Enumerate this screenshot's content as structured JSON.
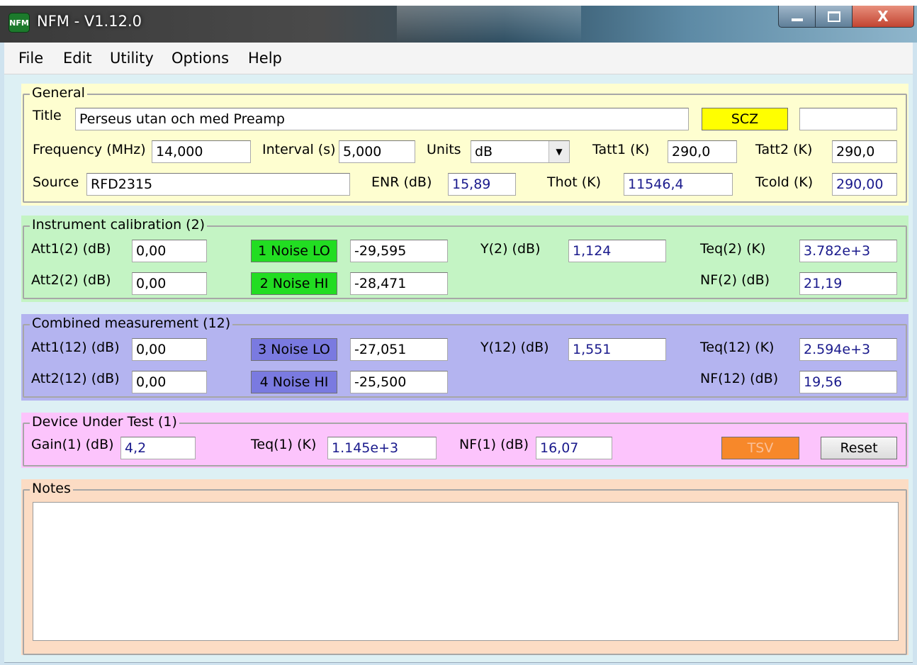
{
  "window": {
    "title": "NFM - V1.12.0",
    "app_icon_label": "NFM",
    "minimize_icon": "minimize-icon",
    "maximize_icon": "maximize-icon",
    "close_icon": "close-icon",
    "close_glyph": "X"
  },
  "menu": [
    "File",
    "Edit",
    "Utility",
    "Options",
    "Help"
  ],
  "general": {
    "legend": "General",
    "title_label": "Title",
    "title_value": "Perseus utan och med Preamp",
    "scz_label": "SCZ",
    "scz_field_value": "",
    "frequency_label": "Frequency (MHz)",
    "frequency_value": "14,000",
    "interval_label": "Interval (s)",
    "interval_value": "5,000",
    "units_label": "Units",
    "units_value": "dB",
    "tatt1_label": "Tatt1 (K)",
    "tatt1_value": "290,0",
    "tatt2_label": "Tatt2 (K)",
    "tatt2_value": "290,0",
    "source_label": "Source",
    "source_value": "RFD2315",
    "enr_label": "ENR (dB)",
    "enr_value": "15,89",
    "thot_label": "Thot (K)",
    "thot_value": "11546,4",
    "tcold_label": "Tcold (K)",
    "tcold_value": "290,00"
  },
  "instrument": {
    "legend": "Instrument calibration (2)",
    "att1_label": "Att1(2) (dB)",
    "att1_value": "0,00",
    "att2_label": "Att2(2) (dB)",
    "att2_value": "0,00",
    "noise_lo_label": "1 Noise LO",
    "noise_lo_value": "-29,595",
    "noise_hi_label": "2 Noise HI",
    "noise_hi_value": "-28,471",
    "y_label": "Y(2) (dB)",
    "y_value": "1,124",
    "teq_label": "Teq(2) (K)",
    "teq_value": "3.782e+3",
    "nf_label": "NF(2) (dB)",
    "nf_value": "21,19"
  },
  "combined": {
    "legend": "Combined measurement (12)",
    "att1_label": "Att1(12) (dB)",
    "att1_value": "0,00",
    "att2_label": "Att2(12) (dB)",
    "att2_value": "0,00",
    "noise_lo_label": "3 Noise LO",
    "noise_lo_value": "-27,051",
    "noise_hi_label": "4 Noise HI",
    "noise_hi_value": "-25,500",
    "y_label": "Y(12) (dB)",
    "y_value": "1,551",
    "teq_label": "Teq(12) (K)",
    "teq_value": "2.594e+3",
    "nf_label": "NF(12) (dB)",
    "nf_value": "19,56"
  },
  "dut": {
    "legend": "Device Under Test (1)",
    "gain_label": "Gain(1) (dB)",
    "gain_value": "4,2",
    "teq_label": "Teq(1) (K)",
    "teq_value": "1.145e+3",
    "nf_label": "NF(1) (dB)",
    "nf_value": "16,07",
    "tsv_label": "TSV",
    "reset_label": "Reset"
  },
  "notes": {
    "legend": "Notes",
    "value": ""
  },
  "colors": {
    "general_bg": "#fefed0",
    "instrument_bg": "#c4f4c4",
    "combined_bg": "#b4b4f0",
    "dut_bg": "#fcc4fc",
    "notes_bg": "#fcdcc4",
    "scz_button": "#ffff00",
    "noise_button_green": "#22dd22",
    "noise_button_blue": "#7a7ae0",
    "tsv_button": "#f7882a"
  }
}
